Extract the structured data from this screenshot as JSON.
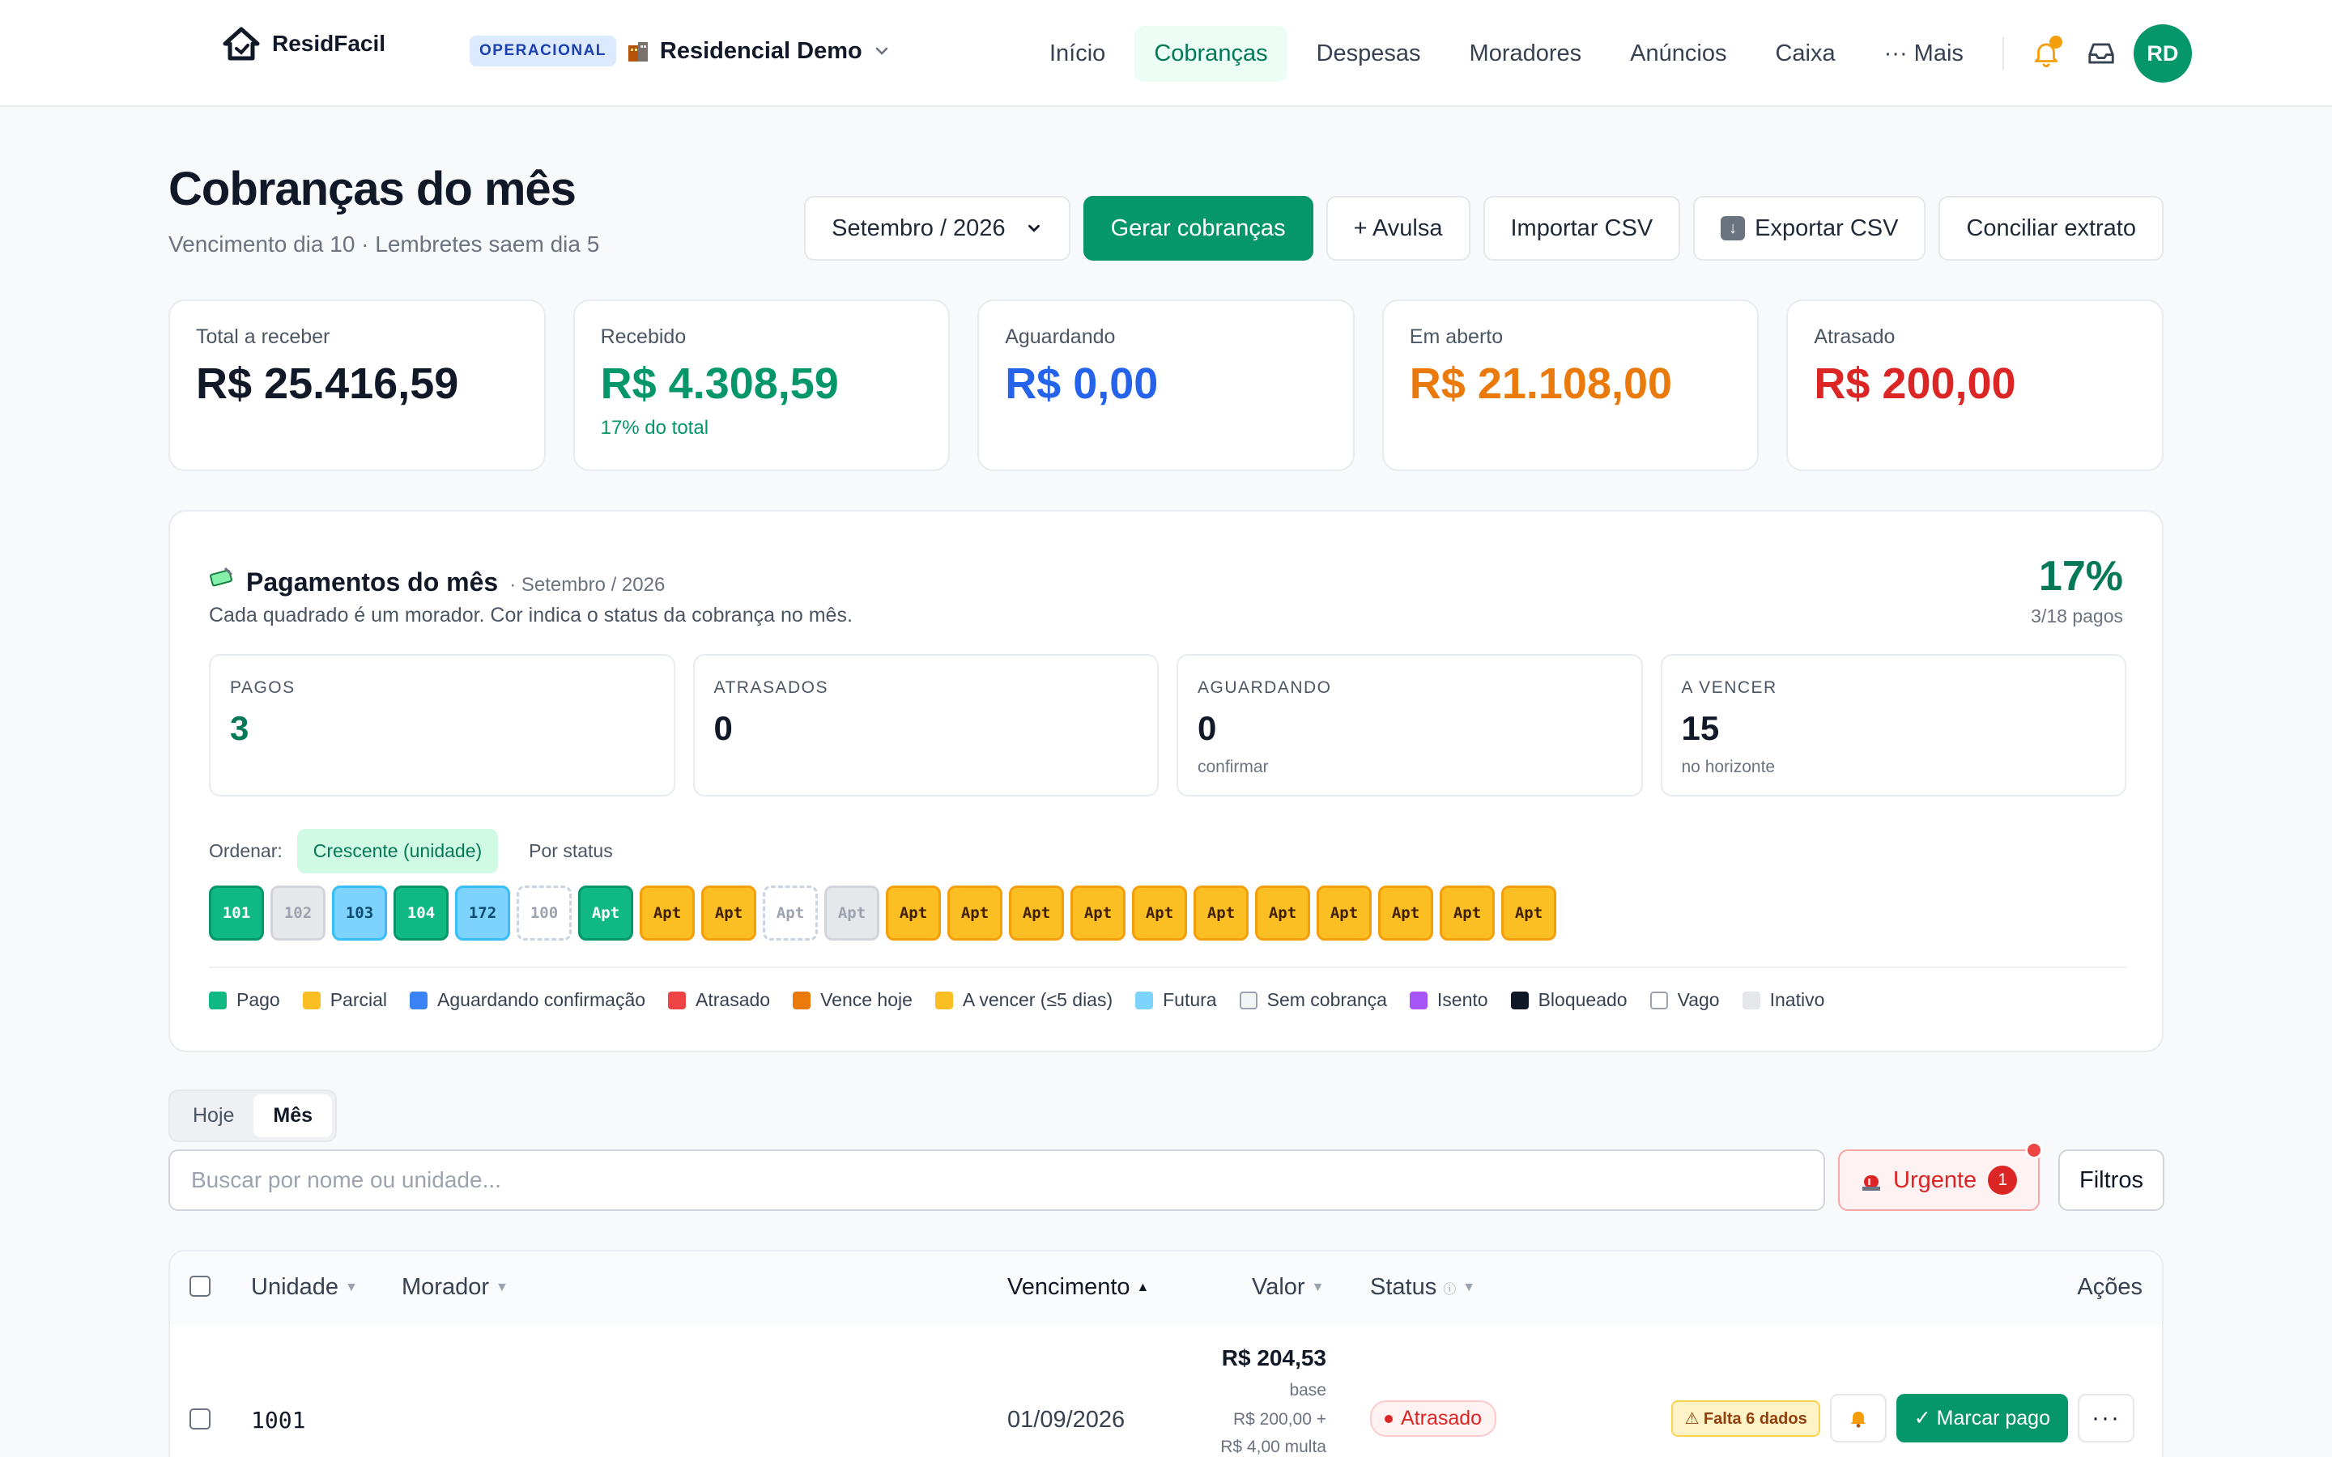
{
  "app": {
    "name": "ResidFacil"
  },
  "condo": {
    "badge": "OPERACIONAL",
    "name": "Residencial Demo"
  },
  "nav": {
    "items": [
      "Início",
      "Cobranças",
      "Despesas",
      "Moradores",
      "Anúncios",
      "Caixa",
      "··· Mais"
    ],
    "active": "Cobranças"
  },
  "user": {
    "initials": "RD"
  },
  "header": {
    "title": "Cobranças do mês",
    "subtitle": "Vencimento dia 10 · Lembretes saem dia 5",
    "month_select": "Setembro / 2026",
    "buttons": {
      "generate": "Gerar cobranças",
      "single": "+ Avulsa",
      "import": "Importar CSV",
      "export": "Exportar CSV",
      "reconcile": "Conciliar extrato"
    }
  },
  "stats": [
    {
      "label": "Total a receber",
      "value": "R$ 25.416,59",
      "color": "#111827"
    },
    {
      "label": "Recebido",
      "value": "R$ 4.308,59",
      "sub": "17% do total",
      "color": "#059669"
    },
    {
      "label": "Aguardando",
      "value": "R$ 0,00",
      "color": "#2563eb"
    },
    {
      "label": "Em aberto",
      "value": "R$ 21.108,00",
      "color": "#ea7a0c"
    },
    {
      "label": "Atrasado",
      "value": "R$ 200,00",
      "color": "#dc2626"
    }
  ],
  "payments": {
    "title": "Pagamentos do mês",
    "month": "· Setembro / 2026",
    "description": "Cada quadrado é um morador. Cor indica o status da cobrança no mês.",
    "percent": "17%",
    "paid_ratio": "3/18 pagos",
    "mini": [
      {
        "label": "PAGOS",
        "value": "3",
        "sub": "",
        "color": "#047857"
      },
      {
        "label": "ATRASADOS",
        "value": "0",
        "sub": "",
        "color": "#111827"
      },
      {
        "label": "AGUARDANDO",
        "value": "0",
        "sub": "confirmar",
        "color": "#111827"
      },
      {
        "label": "A VENCER",
        "value": "15",
        "sub": "no horizonte",
        "color": "#111827"
      }
    ],
    "order_label": "Ordenar:",
    "order_options": [
      "Crescente (unidade)",
      "Por status"
    ],
    "tiles": [
      {
        "label": "101",
        "status": "pago"
      },
      {
        "label": "102",
        "status": "inativo"
      },
      {
        "label": "103",
        "status": "futura"
      },
      {
        "label": "104",
        "status": "pago"
      },
      {
        "label": "172",
        "status": "futura"
      },
      {
        "label": "100",
        "status": "vago"
      },
      {
        "label": "Apt",
        "status": "pago"
      },
      {
        "label": "Apt",
        "status": "avencer"
      },
      {
        "label": "Apt",
        "status": "avencer"
      },
      {
        "label": "Apt",
        "status": "vago"
      },
      {
        "label": "Apt",
        "status": "inativo"
      },
      {
        "label": "Apt",
        "status": "avencer"
      },
      {
        "label": "Apt",
        "status": "avencer"
      },
      {
        "label": "Apt",
        "status": "avencer"
      },
      {
        "label": "Apt",
        "status": "avencer"
      },
      {
        "label": "Apt",
        "status": "avencer"
      },
      {
        "label": "Apt",
        "status": "avencer"
      },
      {
        "label": "Apt",
        "status": "avencer"
      },
      {
        "label": "Apt",
        "status": "avencer"
      },
      {
        "label": "Apt",
        "status": "avencer"
      },
      {
        "label": "Apt",
        "status": "avencer"
      },
      {
        "label": "Apt",
        "status": "avencer"
      }
    ],
    "legend": [
      {
        "label": "Pago",
        "color": "#10b981"
      },
      {
        "label": "Parcial",
        "color": "#fbbf24"
      },
      {
        "label": "Aguardando confirmação",
        "color": "#3b82f6"
      },
      {
        "label": "Atrasado",
        "color": "#ef4444"
      },
      {
        "label": "Vence hoje",
        "color": "#ea7a0c"
      },
      {
        "label": "A vencer (≤5 dias)",
        "color": "#fbbf24"
      },
      {
        "label": "Futura",
        "color": "#7dd3fc"
      },
      {
        "label": "Sem cobrança",
        "color": "#f3f4f6"
      },
      {
        "label": "Isento",
        "color": "#a855f7"
      },
      {
        "label": "Bloqueado",
        "color": "#111827"
      },
      {
        "label": "Vago",
        "color": "#ffffff"
      },
      {
        "label": "Inativo",
        "color": "#e5e7eb"
      }
    ]
  },
  "view_toggle": {
    "options": [
      "Hoje",
      "Mês"
    ],
    "active": "Mês"
  },
  "search": {
    "placeholder": "Buscar por nome ou unidade...",
    "value": ""
  },
  "urgent": {
    "label": "Urgente",
    "count": "1"
  },
  "filters": {
    "label": "Filtros"
  },
  "table": {
    "columns": {
      "unit": "Unidade",
      "resident": "Morador",
      "due": "Vencimento",
      "value": "Valor",
      "status": "Status",
      "actions": "Ações"
    },
    "rows": [
      {
        "unit": "1001",
        "resident": "",
        "due": "01/09/2026",
        "value": "R$ 204,53",
        "value_base_label": "base",
        "value_base": "R$ 200,00 +",
        "value_fine": "R$ 4,00 multa",
        "status": "Atrasado",
        "warning": "⚠ Falta 6 dados",
        "mark_paid": "✓ Marcar pago"
      }
    ]
  }
}
